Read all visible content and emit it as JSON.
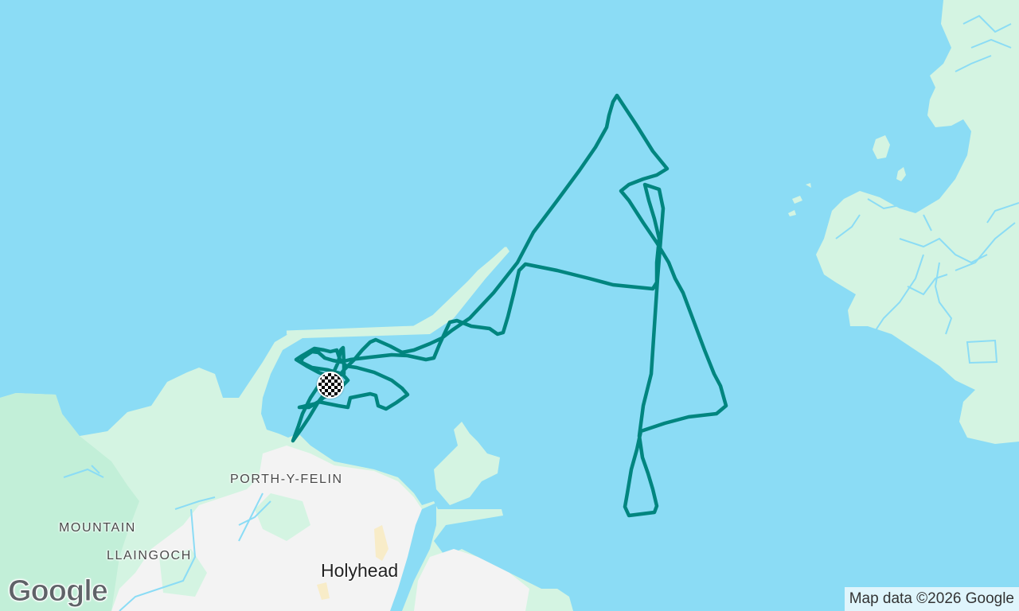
{
  "map": {
    "labels": {
      "porth_y_felin": "PORTH-Y-FELIN",
      "mountain": "MOUNTAIN",
      "llaingoch": "LLAINGOCH",
      "holyhead": "Holyhead"
    },
    "logo": "Google",
    "attribution": "Map data ©2026 Google",
    "colors": {
      "water": "#8bdcf5",
      "land": "#d4f4e2",
      "land_dark": "#bfeed6",
      "urban": "#f3f3f3",
      "track": "#00857f"
    },
    "icons": {
      "finish_marker": "checkered-flag-icon"
    }
  }
}
